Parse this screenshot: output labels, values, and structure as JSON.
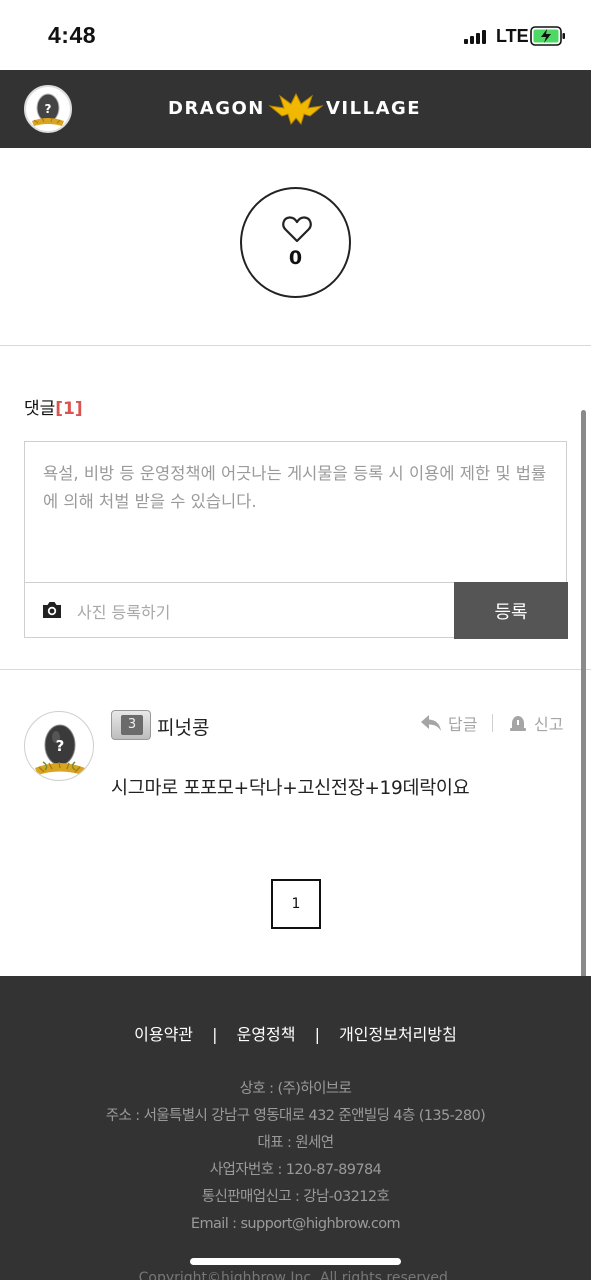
{
  "status_bar": {
    "time": "4:48",
    "network": "LTE"
  },
  "header": {
    "logo_left": "DRAGON",
    "logo_right": "VILLAGE"
  },
  "like": {
    "count": "0"
  },
  "comments": {
    "title": "댓글",
    "count": "[1]",
    "placeholder": "욕설, 비방 등 운영정책에 어긋나는 게시물을 등록 시 이용에 제한 및 법률에 의해 처벌 받을 수 있습니다.",
    "photo_label": "사진 등록하기",
    "submit_label": "등록",
    "items": [
      {
        "level": "3",
        "author": "피넛콩",
        "reply_label": "답글",
        "report_label": "신고",
        "body": "시그마로 포포모+닥나+고신전장+19데락이요"
      }
    ]
  },
  "pagination": {
    "current": "1"
  },
  "footer": {
    "links": [
      "이용약관",
      "운영정책",
      "개인정보처리방침"
    ],
    "info": [
      "상호 : (주)하이브로",
      "주소 : 서울특별시 강남구 영동대로 432 준앤빌딩 4층 (135-280)",
      "대표 : 원세연",
      "사업자번호 : 120-87-89784",
      "통신판매업신고 : 강남-03212호",
      "Email : support@highbrow.com"
    ],
    "copyright": "Copyright©highbrow Inc. All rights reserved."
  },
  "colors": {
    "header_bg": "#333333",
    "accent_red": "#d9534f",
    "submit_bg": "#555555"
  }
}
